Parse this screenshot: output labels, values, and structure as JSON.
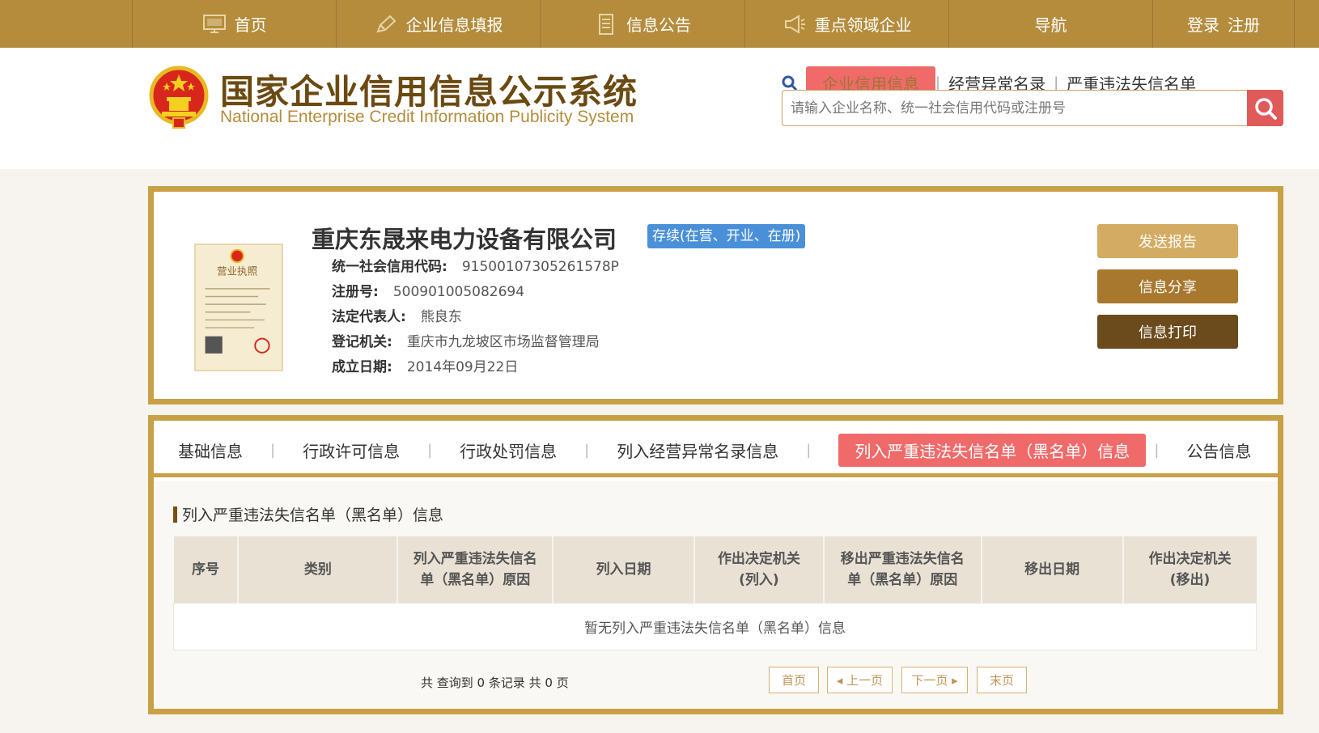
{
  "topnav": {
    "items": [
      {
        "label": "首页",
        "icon": "monitor-icon"
      },
      {
        "label": "企业信息填报",
        "icon": "pen-icon"
      },
      {
        "label": "信息公告",
        "icon": "document-icon"
      },
      {
        "label": "重点领域企业",
        "icon": "megaphone-icon"
      },
      {
        "label": "导航",
        "icon": ""
      }
    ],
    "login": "登录",
    "register": "注册"
  },
  "header": {
    "title_cn": "国家企业信用信息公示系统",
    "title_en": "National Enterprise Credit Information Publicity System"
  },
  "search": {
    "tabs": [
      "企业信用信息",
      "经营异常名录",
      "严重违法失信名单"
    ],
    "placeholder": "请输入企业名称、统一社会信用代码或注册号"
  },
  "company": {
    "name": "重庆东晟来电力设备有限公司",
    "status": "存续(在营、开业、在册)",
    "credit_code_label": "统一社会信用代码:",
    "credit_code": "91500107305261578P",
    "reg_no_label": "注册号:",
    "reg_no": "500901005082694",
    "legal_rep_label": "法定代表人:",
    "legal_rep": "熊良东",
    "authority_label": "登记机关:",
    "authority": "重庆市九龙坡区市场监督管理局",
    "founded_label": "成立日期:",
    "founded": "2014年09月22日",
    "license_title": "营业执照"
  },
  "actions": {
    "send_report": "发送报告",
    "share": "信息分享",
    "print": "信息打印"
  },
  "tabs": [
    "基础信息",
    "行政许可信息",
    "行政处罚信息",
    "列入经营异常名录信息",
    "列入严重违法失信名单（黑名单）信息",
    "公告信息"
  ],
  "section": {
    "title": "列入严重违法失信名单（黑名单）信息",
    "columns": [
      [
        "序号"
      ],
      [
        "类别"
      ],
      [
        "列入严重违法失信名",
        "单（黑名单）原因"
      ],
      [
        "列入日期"
      ],
      [
        "作出决定机关",
        "(列入)"
      ],
      [
        "移出严重违法失信名",
        "单（黑名单）原因"
      ],
      [
        "移出日期"
      ],
      [
        "作出决定机关",
        "(移出)"
      ]
    ],
    "empty_text": "暂无列入严重违法失信名单（黑名单）信息"
  },
  "pager": {
    "summary": "共 查询到 0 条记录 共 0 页",
    "first": "首页",
    "prev": "◂ 上一页",
    "next": "下一页 ▸",
    "last": "末页"
  },
  "colors": {
    "nav_bg": "#b48c3c",
    "accent_gold": "#c8a045",
    "active_tab": "#f06a6a",
    "status_blue": "#4a90d9"
  }
}
